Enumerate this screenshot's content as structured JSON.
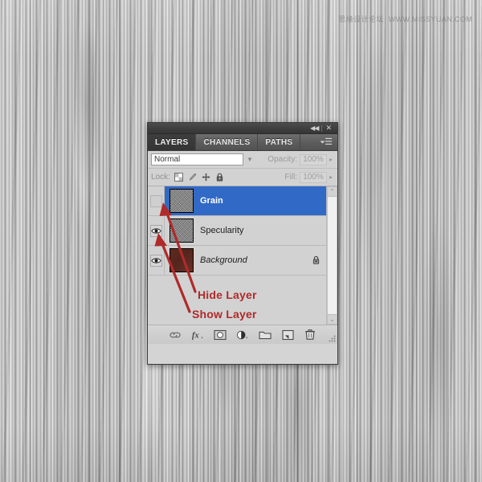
{
  "background": {
    "texture": "grayscale-vertical-wood-grain",
    "base_color": "#bcbcbc"
  },
  "watermark": {
    "cn_text": "思缘设计论坛",
    "url_text": "WWW.MISSYUAN.COM",
    "color": "#7d7d7d"
  },
  "panel": {
    "titlebar": {
      "collapse_icon": "◀◀",
      "close_icon": "✕"
    },
    "tabs": [
      {
        "label": "LAYERS",
        "active": true
      },
      {
        "label": "CHANNELS",
        "active": false
      },
      {
        "label": "PATHS",
        "active": false
      }
    ],
    "menu_icon": "panel-menu-icon",
    "controls": {
      "blend_mode": "Normal",
      "blend_placeholder": "Normal",
      "opacity_label": "Opacity:",
      "opacity_value": "100%",
      "lock_label": "Lock:",
      "lock_icons": [
        "lock-transparency-icon",
        "lock-image-icon",
        "lock-position-icon",
        "lock-all-icon"
      ],
      "fill_label": "Fill:",
      "fill_value": "100%"
    },
    "layers": [
      {
        "name": "Grain",
        "visible": false,
        "selected": true,
        "thumb": "noise",
        "locked": false,
        "italic": false
      },
      {
        "name": "Specularity",
        "visible": true,
        "selected": false,
        "thumb": "noise",
        "locked": false,
        "italic": false
      },
      {
        "name": "Background",
        "visible": true,
        "selected": false,
        "thumb": "solid-brown",
        "locked": true,
        "italic": true
      }
    ],
    "selected_color": "#3169c6",
    "scrollbar": {
      "up_arrow": "⌃",
      "down_arrow": "⌄"
    },
    "footer_icons": [
      "link-layers-icon",
      "layer-style-fx-icon",
      "layer-mask-icon",
      "adjustment-layer-icon",
      "new-group-icon",
      "new-layer-icon",
      "delete-layer-icon"
    ]
  },
  "annotations": {
    "color": "#b02a2a",
    "hide_layer": "Hide Layer",
    "show_layer": "Show Layer"
  }
}
